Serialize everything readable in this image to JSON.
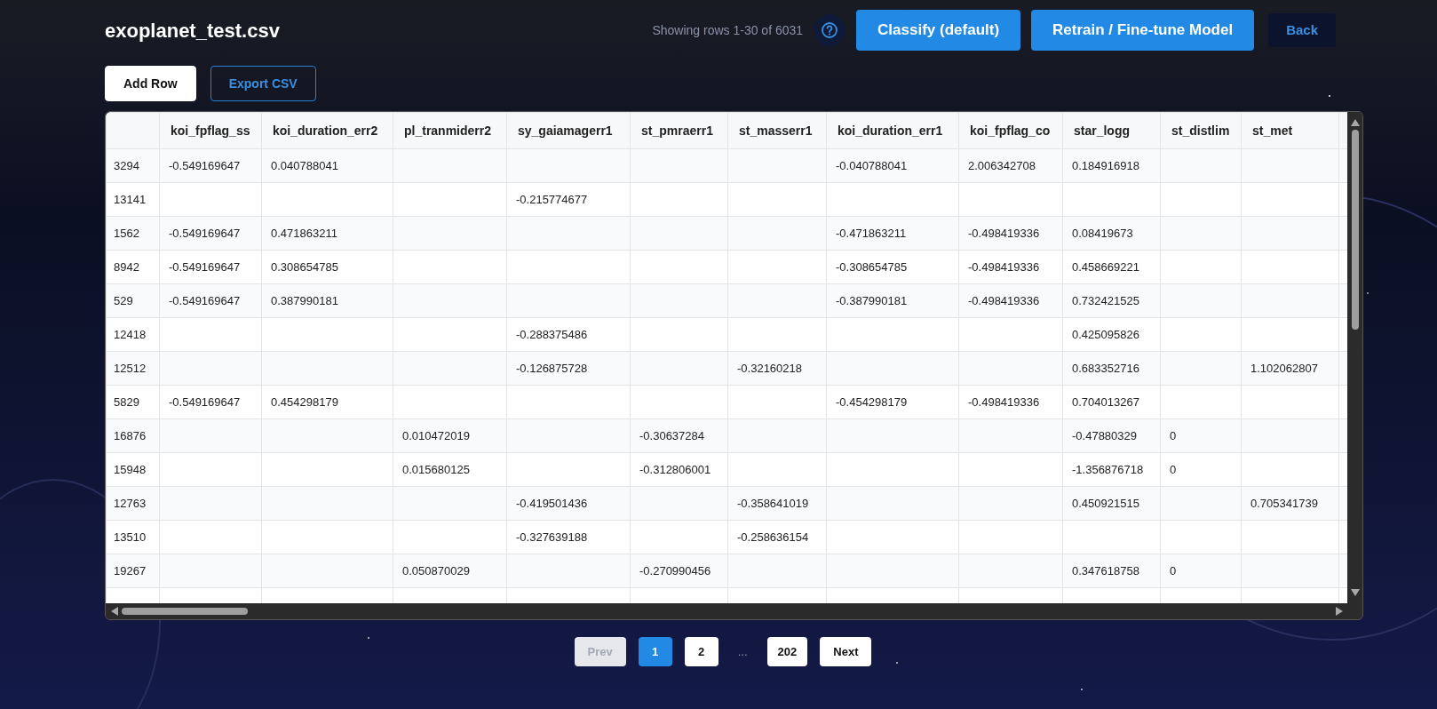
{
  "title": "exoplanet_test.csv",
  "row_info": "Showing rows 1-30 of 6031",
  "actions": [
    {
      "label": "Classify (default)",
      "kind": "primary"
    },
    {
      "label": "Retrain / Fine-tune Model",
      "kind": "primary"
    },
    {
      "label": "Back",
      "kind": "dark"
    }
  ],
  "toolbar": [
    {
      "label": "Add Row",
      "kind": "solid"
    },
    {
      "label": "Export CSV",
      "kind": "outline"
    }
  ],
  "table": {
    "columns": [
      "koi_fpflag_ss",
      "koi_duration_err2",
      "pl_tranmiderr2",
      "sy_gaiamagerr1",
      "st_pmraerr1",
      "st_masserr1",
      "koi_duration_err1",
      "koi_fpflag_co",
      "star_logg",
      "st_distlim",
      "st_met"
    ],
    "rows": [
      {
        "index": "3294",
        "cells": [
          "-0.549169647",
          "0.040788041",
          null,
          null,
          null,
          null,
          "-0.040788041",
          "2.006342708",
          "0.184916918",
          null,
          null
        ]
      },
      {
        "index": "13141",
        "cells": [
          null,
          null,
          null,
          "-0.215774677",
          null,
          null,
          null,
          null,
          null,
          null,
          null
        ]
      },
      {
        "index": "1562",
        "cells": [
          "-0.549169647",
          "0.471863211",
          null,
          null,
          null,
          null,
          "-0.471863211",
          "-0.498419336",
          "0.08419673",
          null,
          null
        ]
      },
      {
        "index": "8942",
        "cells": [
          "-0.549169647",
          "0.308654785",
          null,
          null,
          null,
          null,
          "-0.308654785",
          "-0.498419336",
          "0.458669221",
          null,
          null
        ]
      },
      {
        "index": "529",
        "cells": [
          "-0.549169647",
          "0.387990181",
          null,
          null,
          null,
          null,
          "-0.387990181",
          "-0.498419336",
          "0.732421525",
          null,
          null
        ]
      },
      {
        "index": "12418",
        "cells": [
          null,
          null,
          null,
          "-0.288375486",
          null,
          null,
          null,
          null,
          "0.425095826",
          null,
          null
        ]
      },
      {
        "index": "12512",
        "cells": [
          null,
          null,
          null,
          "-0.126875728",
          null,
          "-0.32160218",
          null,
          null,
          "0.683352716",
          null,
          "1.102062807"
        ]
      },
      {
        "index": "5829",
        "cells": [
          "-0.549169647",
          "0.454298179",
          null,
          null,
          null,
          null,
          "-0.454298179",
          "-0.498419336",
          "0.704013267",
          null,
          null
        ]
      },
      {
        "index": "16876",
        "cells": [
          null,
          null,
          "0.010472019",
          null,
          "-0.30637284",
          null,
          null,
          null,
          "-0.47880329",
          "0",
          null
        ]
      },
      {
        "index": "15948",
        "cells": [
          null,
          null,
          "0.015680125",
          null,
          "-0.312806001",
          null,
          null,
          null,
          "-1.356876718",
          "0",
          null
        ]
      },
      {
        "index": "12763",
        "cells": [
          null,
          null,
          null,
          "-0.419501436",
          null,
          "-0.358641019",
          null,
          null,
          "0.450921515",
          null,
          "0.705341739"
        ]
      },
      {
        "index": "13510",
        "cells": [
          null,
          null,
          null,
          "-0.327639188",
          null,
          "-0.258636154",
          null,
          null,
          null,
          null,
          null
        ]
      },
      {
        "index": "19267",
        "cells": [
          null,
          null,
          "0.050870029",
          null,
          "-0.270990456",
          null,
          null,
          null,
          "0.347618758",
          "0",
          null
        ]
      }
    ]
  },
  "pagination": [
    {
      "label": "Prev",
      "kind": "nav",
      "disabled": true
    },
    {
      "label": "1",
      "kind": "page",
      "selected": true
    },
    {
      "label": "2",
      "kind": "page",
      "selected": false
    },
    {
      "label": "...",
      "kind": "gap"
    },
    {
      "label": "202",
      "kind": "page",
      "selected": false
    },
    {
      "label": "Next",
      "kind": "nav",
      "disabled": false
    }
  ]
}
